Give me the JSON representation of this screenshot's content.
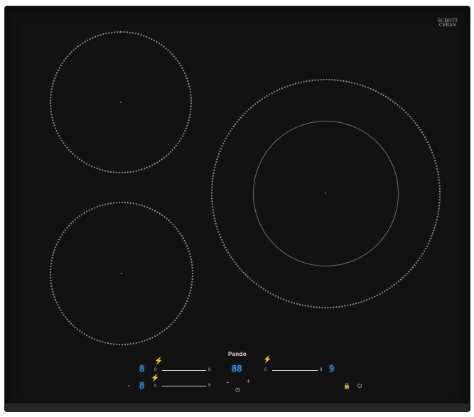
{
  "hob": {
    "brand_line1": "SCHOTT",
    "brand_line2": "CERAN",
    "brand_text": "Pando"
  },
  "controls": {
    "left_top_display": "8",
    "left_bottom_display": "8",
    "center_display": "88",
    "right_display": "9",
    "slider_min": "0",
    "slider_max": "9",
    "icons": {
      "booster_top": "booster-icon",
      "booster_bottom": "booster-icon",
      "right_booster": "booster-icon",
      "timer_minus": "minus-icon",
      "timer_plus": "plus-icon",
      "clock": "clock-icon",
      "lock": "lock-icon",
      "power": "power-icon"
    }
  },
  "colors": {
    "hob_surface": "#121212",
    "zone_outline": "#8a8a8a",
    "display_blue": "#3aa0ff"
  }
}
